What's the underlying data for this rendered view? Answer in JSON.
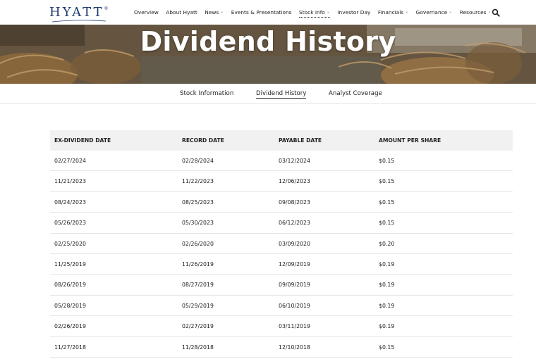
{
  "header": {
    "logo": "HYATT",
    "nav": [
      {
        "label": "Overview",
        "dropdown": false
      },
      {
        "label": "About Hyatt",
        "dropdown": false
      },
      {
        "label": "News",
        "dropdown": true
      },
      {
        "label": "Events & Presentations",
        "dropdown": false
      },
      {
        "label": "Stock Info",
        "dropdown": true,
        "active": true
      },
      {
        "label": "Investor Day",
        "dropdown": false
      },
      {
        "label": "Financials",
        "dropdown": true
      },
      {
        "label": "Governance",
        "dropdown": true
      },
      {
        "label": "Resources",
        "dropdown": true
      }
    ],
    "search_icon": "search-icon"
  },
  "hero": {
    "title": "Dividend History"
  },
  "subnav": {
    "items": [
      {
        "label": "Stock Information"
      },
      {
        "label": "Dividend History",
        "active": true
      },
      {
        "label": "Analyst Coverage"
      }
    ]
  },
  "table": {
    "headers": [
      "EX-DIVIDEND DATE",
      "RECORD DATE",
      "PAYABLE DATE",
      "AMOUNT PER SHARE"
    ],
    "rows": [
      [
        "02/27/2024",
        "02/28/2024",
        "03/12/2024",
        "$0.15"
      ],
      [
        "11/21/2023",
        "11/22/2023",
        "12/06/2023",
        "$0.15"
      ],
      [
        "08/24/2023",
        "08/25/2023",
        "09/08/2023",
        "$0.15"
      ],
      [
        "05/26/2023",
        "05/30/2023",
        "06/12/2023",
        "$0.15"
      ],
      [
        "02/25/2020",
        "02/26/2020",
        "03/09/2020",
        "$0.20"
      ],
      [
        "11/25/2019",
        "11/26/2019",
        "12/09/2019",
        "$0.19"
      ],
      [
        "08/26/2019",
        "08/27/2019",
        "09/09/2019",
        "$0.19"
      ],
      [
        "05/28/2019",
        "05/29/2019",
        "06/10/2019",
        "$0.19"
      ],
      [
        "02/26/2019",
        "02/27/2019",
        "03/11/2019",
        "$0.19"
      ],
      [
        "11/27/2018",
        "11/28/2018",
        "12/10/2018",
        "$0.15"
      ]
    ]
  }
}
